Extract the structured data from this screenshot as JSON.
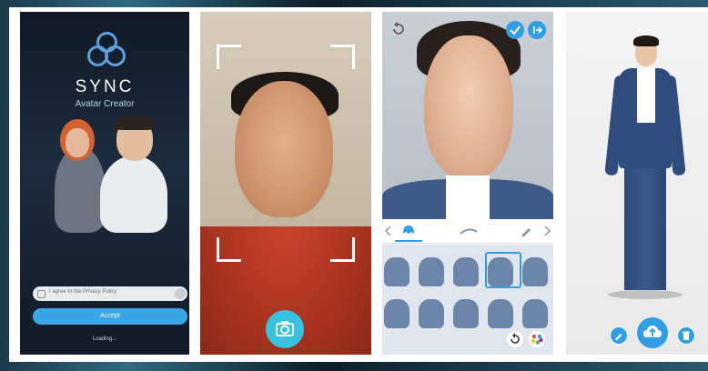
{
  "screen1": {
    "app_name": "SYNC",
    "app_subtitle": "Avatar Creator",
    "privacy_label": "I agree to the Privacy Policy",
    "accept_label": "Accept",
    "loading_text": "Loading..."
  },
  "screen2": {
    "capture_icon": "camera-icon"
  },
  "screen3": {
    "icons": [
      "undo-icon",
      "check-icon",
      "exit-icon",
      "hair-icon",
      "brow-icon",
      "pencil-icon",
      "reset-icon",
      "palette-icon"
    ],
    "selected_hairstyle": 4
  },
  "screen4": {
    "icons": [
      "edit-icon",
      "upload-icon",
      "delete-icon"
    ]
  },
  "colors": {
    "accent": "#3aa6e8",
    "camera_button": "#35c3df",
    "selection": "#2f9ee6"
  }
}
